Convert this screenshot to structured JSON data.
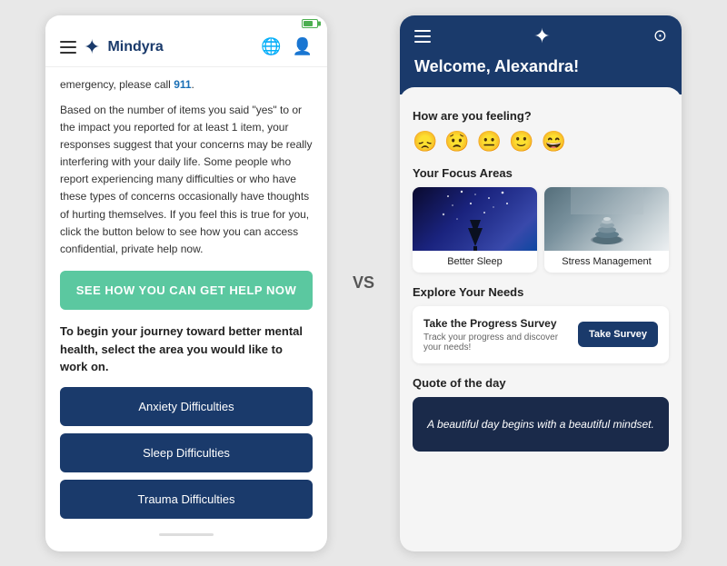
{
  "left_phone": {
    "status": {
      "battery_label": "battery"
    },
    "header": {
      "menu_label": "menu",
      "brand": "Mindyra",
      "globe_label": "globe",
      "user_label": "user profile"
    },
    "content": {
      "emergency_prefix": "emergency, please call ",
      "emergency_number": "911",
      "emergency_suffix": ".",
      "description": "Based on the number of items you said \"yes\" to or the impact you reported for at least 1 item, your responses suggest that your concerns may be really interfering with your daily life. Some people who report experiencing many difficulties or who have these types of concerns occasionally have thoughts of hurting themselves. If you feel this is true for you, click the button below to see how you can access confidential, private help now.",
      "help_btn": "SEE HOW YOU CAN GET HELP NOW",
      "journey_text": "To begin your journey toward better mental health, select the area you would like to work on.",
      "focus_buttons": [
        "Anxiety Difficulties",
        "Sleep Difficulties",
        "Trauma Difficulties"
      ]
    }
  },
  "vs_label": "VS",
  "right_phone": {
    "header": {
      "menu_label": "menu",
      "brand_label": "Mindyra star",
      "user_label": "user account",
      "welcome": "Welcome, Alexandra!"
    },
    "content": {
      "feeling_label": "How are you feeling?",
      "moods": [
        "😞",
        "😟",
        "😐",
        "🙂",
        "😄"
      ],
      "focus_areas_label": "Your Focus Areas",
      "focus_areas": [
        {
          "label": "Better Sleep",
          "type": "sleep"
        },
        {
          "label": "Stress Management",
          "type": "stress"
        }
      ],
      "explore_label": "Explore Your Needs",
      "explore_title": "Take the Progress Survey",
      "explore_subtitle": "Track your progress and discover your needs!",
      "survey_btn": "Take Survey",
      "quote_label": "Quote of the day",
      "quote": "A beautiful day begins with a beautiful mindset."
    }
  }
}
